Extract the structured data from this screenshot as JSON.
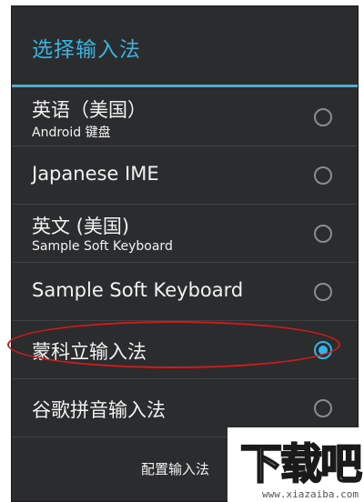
{
  "dialog": {
    "title": "选择输入法",
    "accent_color": "#33b5e5",
    "background_color": "#2b2c2e"
  },
  "input_methods": [
    {
      "name": "英语（美国）",
      "subtitle": "Android 键盘",
      "selected": false
    },
    {
      "name": "Japanese IME",
      "subtitle": "",
      "selected": false
    },
    {
      "name": "英文 (美国)",
      "subtitle": "Sample Soft Keyboard",
      "selected": false
    },
    {
      "name": "Sample Soft Keyboard",
      "subtitle": "",
      "selected": false
    },
    {
      "name": "蒙科立输入法",
      "subtitle": "",
      "selected": true
    },
    {
      "name": "谷歌拼音输入法",
      "subtitle": "",
      "selected": false
    }
  ],
  "footer": {
    "configure_label": "配置输入法"
  },
  "annotation": {
    "highlight_color": "#d11b1b"
  },
  "watermark": {
    "logo_text": "下载吧",
    "url": "www.xiazaiba.com"
  }
}
